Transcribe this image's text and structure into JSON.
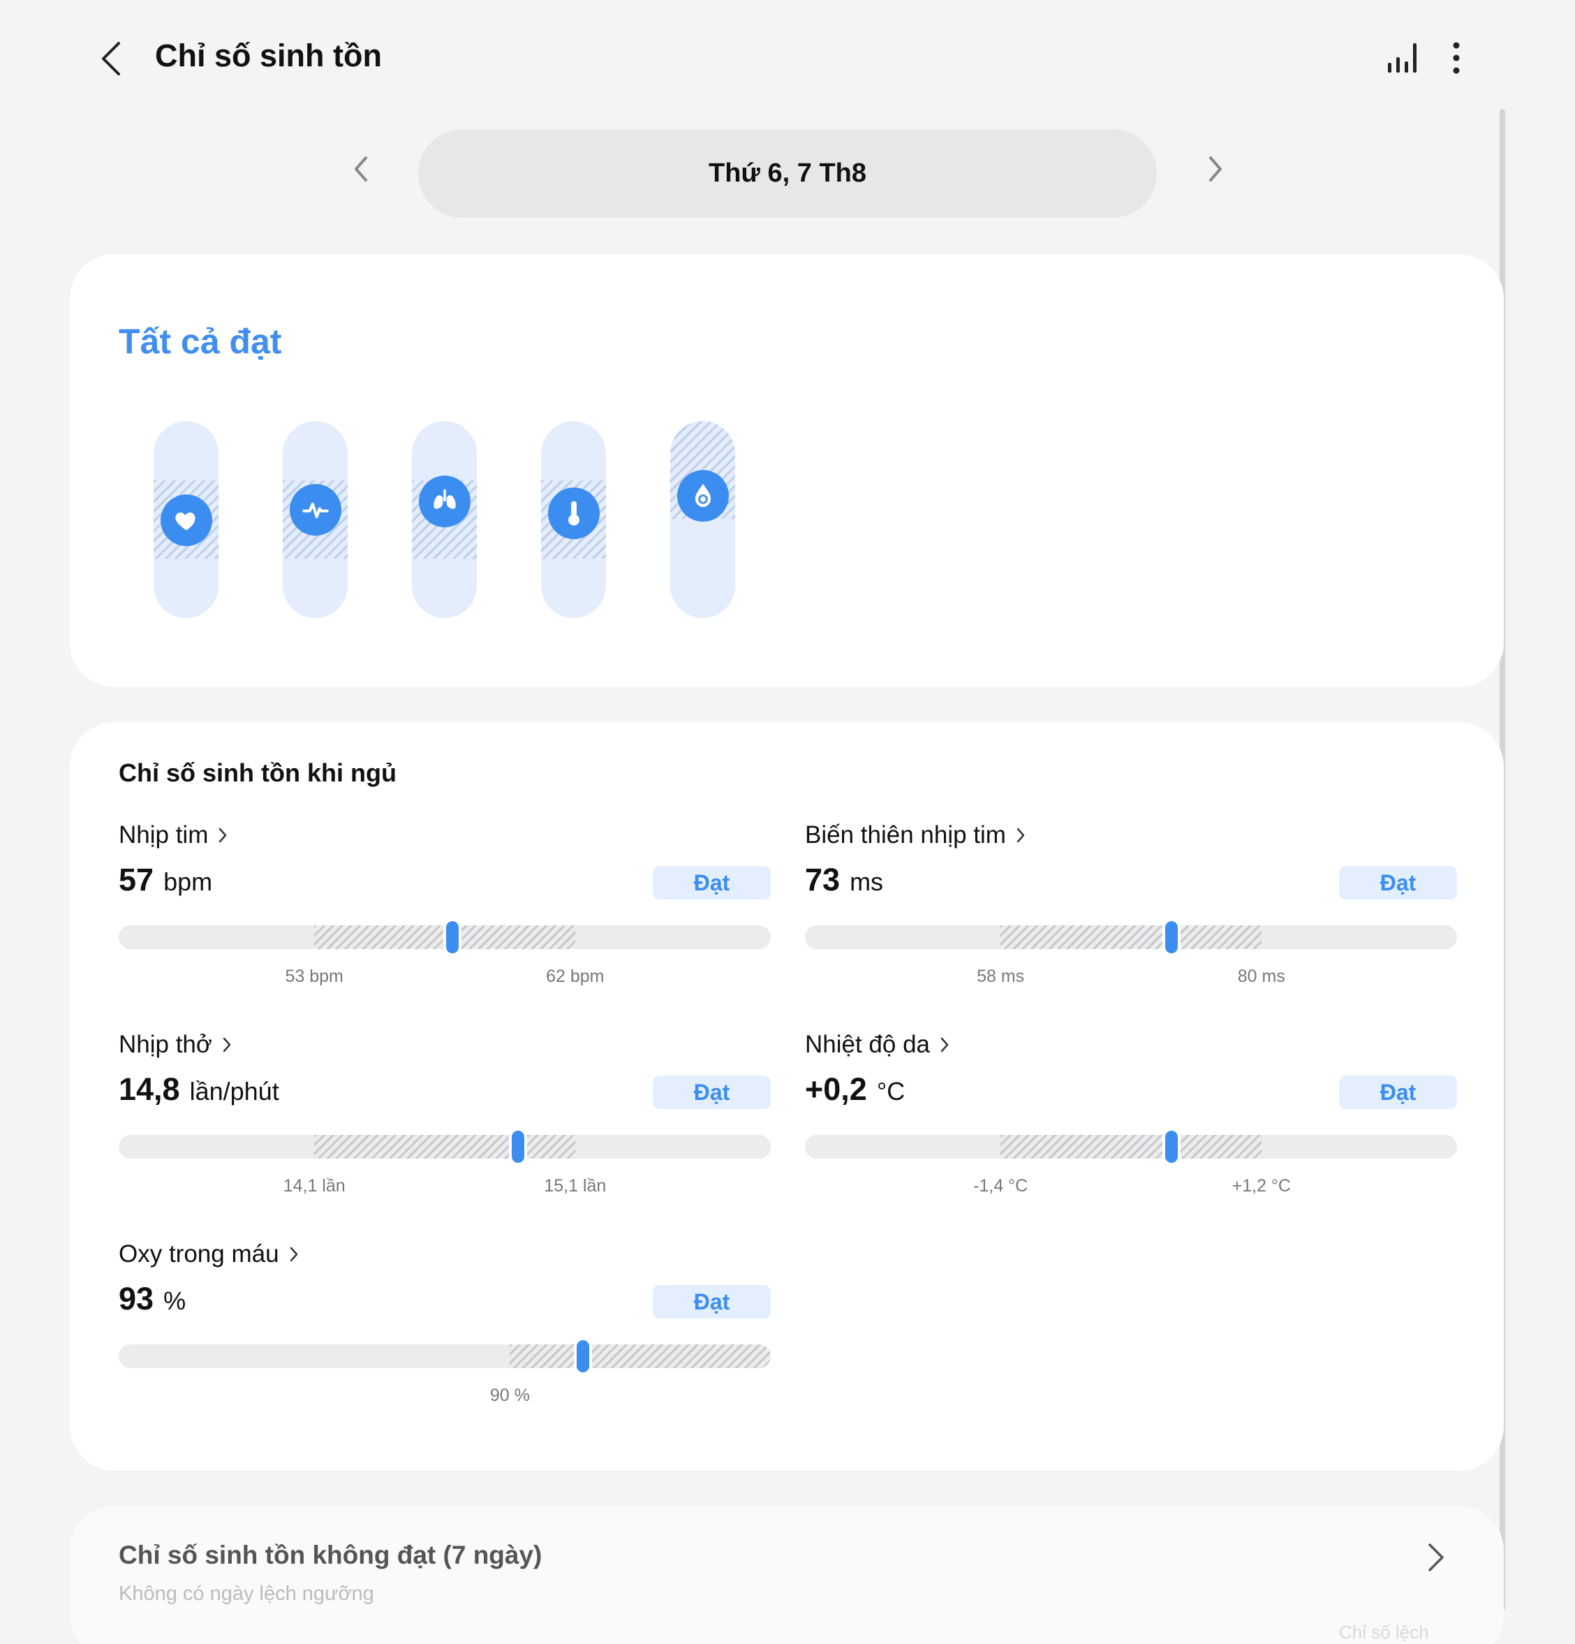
{
  "header": {
    "title": "Chỉ số sinh tồn"
  },
  "date": {
    "label": "Thứ 6, 7 Th8"
  },
  "summary": {
    "status": "Tất cả đạt",
    "indicators": [
      {
        "icon": "heart-icon"
      },
      {
        "icon": "pulse-icon"
      },
      {
        "icon": "lungs-icon"
      },
      {
        "icon": "thermometer-icon"
      },
      {
        "icon": "oxygen-drop-icon"
      }
    ]
  },
  "sleep": {
    "title": "Chỉ số sinh tồn khi ngủ",
    "metrics": [
      {
        "label": "Nhịp tim",
        "value": "57",
        "unit": "bpm",
        "badge": "Đạt",
        "low_label": "53 bpm",
        "high_label": "62 bpm",
        "range_start": 0.3,
        "range_end": 0.7,
        "marker": 0.512
      },
      {
        "label": "Biến thiên nhịp tim",
        "value": "73",
        "unit": "ms",
        "badge": "Đạt",
        "low_label": "58 ms",
        "high_label": "80 ms",
        "range_start": 0.3,
        "range_end": 0.7,
        "marker": 0.562
      },
      {
        "label": "Nhịp thở",
        "value": "14,8",
        "unit": "lần/phút",
        "badge": "Đạt",
        "low_label": "14,1 lần",
        "high_label": "15,1 lần",
        "range_start": 0.3,
        "range_end": 0.7,
        "marker": 0.612
      },
      {
        "label": "Nhiệt độ da",
        "value": "+0,2",
        "unit": "°C",
        "badge": "Đạt",
        "low_label": "-1,4 °C",
        "high_label": "+1,2 °C",
        "range_start": 0.3,
        "range_end": 0.7,
        "marker": 0.562
      },
      {
        "label": "Oxy trong máu",
        "value": "93",
        "unit": "%",
        "badge": "Đạt",
        "low_label": "90 %",
        "high_label": "",
        "range_start": 0.6,
        "range_end": 1.0,
        "marker": 0.712
      }
    ]
  },
  "weekly": {
    "title": "Chỉ số sinh tồn không đạt (7 ngày)",
    "subtitle": "Không có ngày lệch ngưỡng",
    "more": "Chỉ số lệch"
  }
}
